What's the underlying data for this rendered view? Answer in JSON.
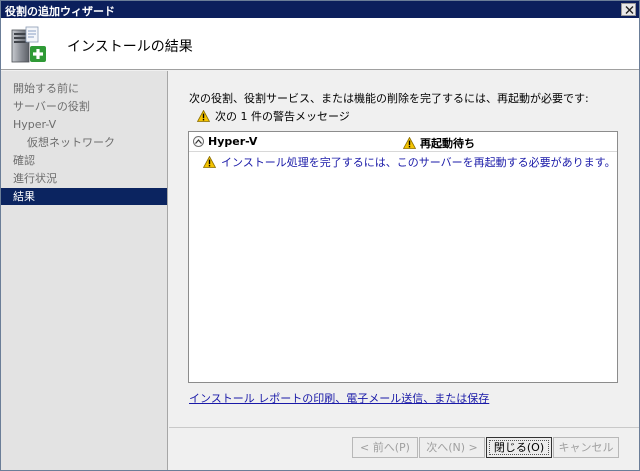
{
  "window": {
    "title": "役割の追加ウィザード"
  },
  "header": {
    "title": "インストールの結果",
    "icon": "server-add-icon"
  },
  "sidebar": {
    "items": [
      {
        "label": "開始する前に",
        "state": "normal"
      },
      {
        "label": "サーバーの役割",
        "state": "normal"
      },
      {
        "label": "Hyper-V",
        "state": "normal"
      },
      {
        "label": "仮想ネットワーク",
        "state": "sub"
      },
      {
        "label": "確認",
        "state": "normal"
      },
      {
        "label": "進行状況",
        "state": "normal"
      },
      {
        "label": "結果",
        "state": "active"
      }
    ]
  },
  "main": {
    "intro": "次の役割、役割サービス、または機能の削除を完了するには、再起動が必要です:",
    "warning_summary": "次の 1 件の警告メッセージ",
    "results": [
      {
        "role": "Hyper-V",
        "status": "再起動待ち",
        "detail": "インストール処理を完了するには、このサーバーを再起動する必要があります。"
      }
    ],
    "report_link": "インストール レポートの印刷、電子メール送信、または保存"
  },
  "buttons": {
    "prev": "< 前へ(P)",
    "next": "次へ(N) >",
    "close": "閉じる(O)",
    "cancel": "キャンセル"
  },
  "colors": {
    "titlebar": "#0b1f5c",
    "active_nav": "#0b2460",
    "link": "#1a1aa8",
    "warning": "#f5c400"
  }
}
